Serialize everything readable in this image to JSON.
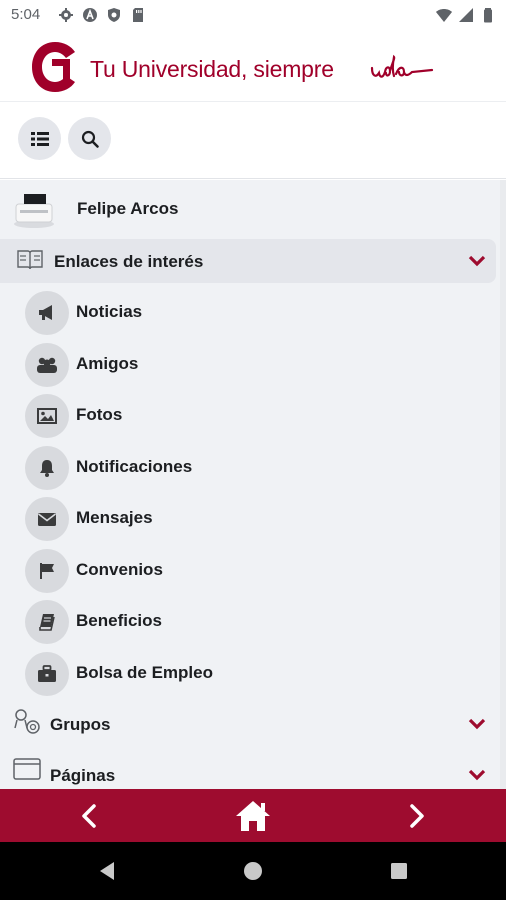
{
  "status_bar": {
    "time": "5:04",
    "left_icons": [
      "gear-icon",
      "a-badge-icon",
      "shield-icon",
      "sd-card-icon"
    ],
    "right_icons": [
      "wifi-icon",
      "signal-icon",
      "battery-icon"
    ]
  },
  "brand": {
    "tagline": "Tu Universidad, siempre",
    "logo": "udla-logo",
    "script_logo_text": "udla",
    "accent_color": "#a0002a"
  },
  "toolbar": {
    "buttons": [
      "list-icon",
      "search-icon"
    ]
  },
  "profile": {
    "name": "Felipe Arcos"
  },
  "menu": {
    "sections": [
      {
        "label": "Enlaces de interés",
        "icon": "book-icon",
        "expanded": true,
        "items": [
          {
            "label": "Noticias",
            "icon": "megaphone-icon"
          },
          {
            "label": "Amigos",
            "icon": "users-icon"
          },
          {
            "label": "Fotos",
            "icon": "image-icon"
          },
          {
            "label": "Notificaciones",
            "icon": "bell-icon"
          },
          {
            "label": "Mensajes",
            "icon": "envelope-icon"
          },
          {
            "label": "Convenios",
            "icon": "flag-icon"
          },
          {
            "label": "Beneficios",
            "icon": "book-icon"
          },
          {
            "label": "Bolsa de Empleo",
            "icon": "briefcase-icon"
          }
        ]
      },
      {
        "label": "Grupos",
        "icon": "groups-icon",
        "expanded": false
      },
      {
        "label": "Páginas",
        "icon": "window-icon",
        "expanded": false
      }
    ]
  },
  "bottom_bar": {
    "color": "#9e0c2f",
    "buttons": [
      "chevron-left-icon",
      "home-icon",
      "chevron-right-icon"
    ]
  },
  "android_nav": {
    "buttons": [
      "back-icon",
      "home-circle-icon",
      "recents-icon"
    ]
  }
}
